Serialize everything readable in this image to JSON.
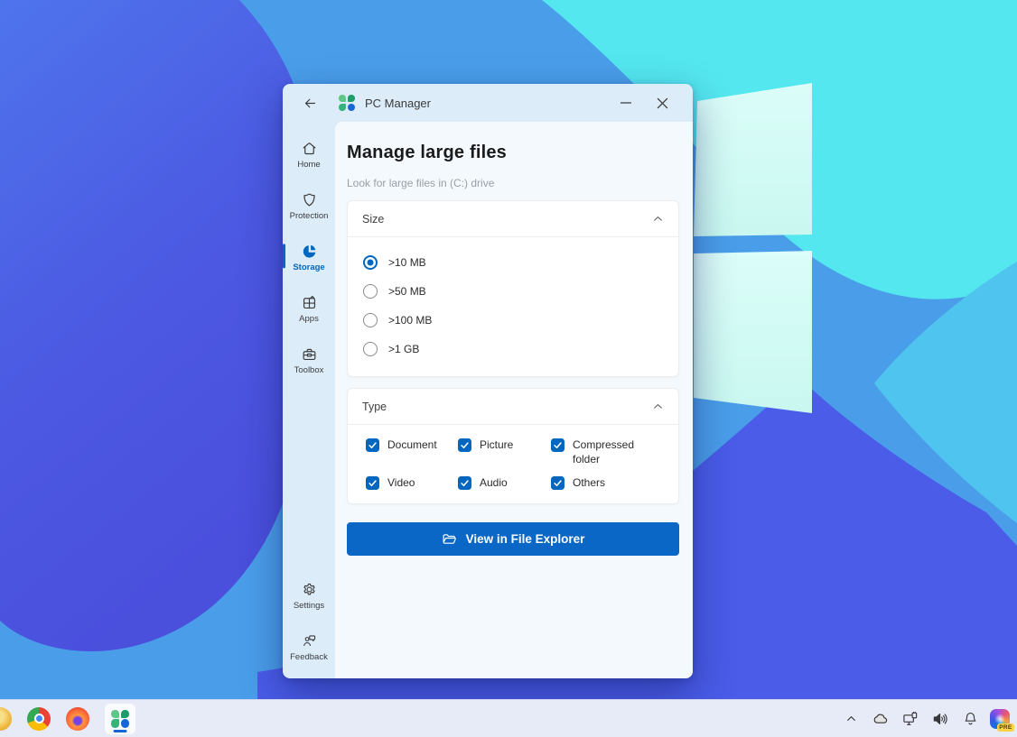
{
  "window": {
    "title": "PC Manager",
    "sidebar": {
      "items": [
        {
          "label": "Home",
          "active": false
        },
        {
          "label": "Protection",
          "active": false
        },
        {
          "label": "Storage",
          "active": true
        },
        {
          "label": "Apps",
          "active": false
        },
        {
          "label": "Toolbox",
          "active": false
        }
      ],
      "bottom_items": [
        {
          "label": "Settings"
        },
        {
          "label": "Feedback"
        }
      ]
    },
    "content": {
      "title": "Manage large files",
      "subtitle": "Look for large files in (C:) drive",
      "size_section": {
        "header": "Size",
        "options": [
          {
            "label": ">10 MB",
            "selected": true
          },
          {
            "label": ">50 MB",
            "selected": false
          },
          {
            "label": ">100 MB",
            "selected": false
          },
          {
            "label": ">1 GB",
            "selected": false
          }
        ]
      },
      "type_section": {
        "header": "Type",
        "options": [
          {
            "label": "Document",
            "checked": true
          },
          {
            "label": "Picture",
            "checked": true
          },
          {
            "label": "Compressed folder",
            "checked": true
          },
          {
            "label": "Video",
            "checked": true
          },
          {
            "label": "Audio",
            "checked": true
          },
          {
            "label": "Others",
            "checked": true
          }
        ]
      },
      "action_button": {
        "label": "View in File Explorer"
      }
    }
  },
  "taskbar": {
    "copilot_badge": "PRE"
  },
  "colors": {
    "accent": "#0067c0",
    "titlebar_bg": "#dcecf9",
    "content_bg": "#f3f9fd",
    "taskbar_bg": "#e7eaf7",
    "button_bg": "#0b67c6"
  }
}
